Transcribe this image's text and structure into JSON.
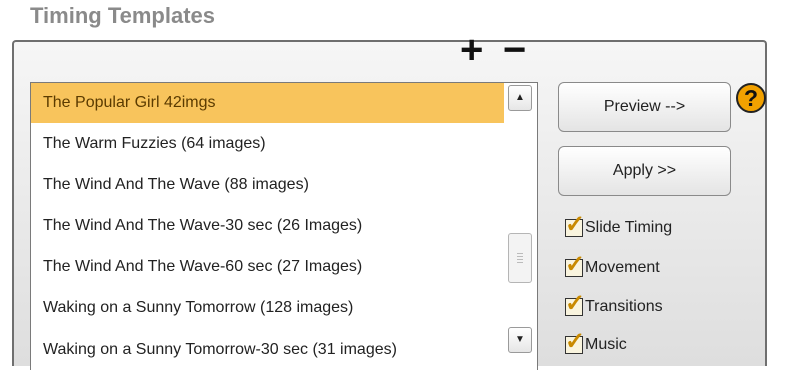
{
  "header": {
    "title": "Timing Templates"
  },
  "toolbar": {
    "add_label": "+",
    "remove_label": "−",
    "help_label": "?"
  },
  "templates": {
    "items": [
      {
        "label": "The Popular Girl 42imgs",
        "selected": true
      },
      {
        "label": "The Warm Fuzzies (64 images)",
        "selected": false
      },
      {
        "label": "The Wind And The Wave (88 images)",
        "selected": false
      },
      {
        "label": "The Wind And The Wave-30 sec (26 Images)",
        "selected": false
      },
      {
        "label": "The Wind And The Wave-60 sec (27 Images)",
        "selected": false
      },
      {
        "label": "Waking on a Sunny Tomorrow (128 images)",
        "selected": false
      },
      {
        "label": "Waking on a Sunny Tomorrow-30 sec (31 images)",
        "selected": false
      }
    ],
    "scroll_up_icon": "▲",
    "scroll_down_icon": "▼"
  },
  "actions": {
    "preview_label": "Preview -->",
    "apply_label": "Apply >>"
  },
  "options": [
    {
      "label": "Slide Timing",
      "checked": true
    },
    {
      "label": "Movement",
      "checked": true
    },
    {
      "label": "Transitions",
      "checked": true
    },
    {
      "label": "Music",
      "checked": true
    }
  ],
  "colors": {
    "selected_row": "#f8c45c",
    "help_badge": "#f2a100",
    "check_mark": "#c98a00"
  }
}
